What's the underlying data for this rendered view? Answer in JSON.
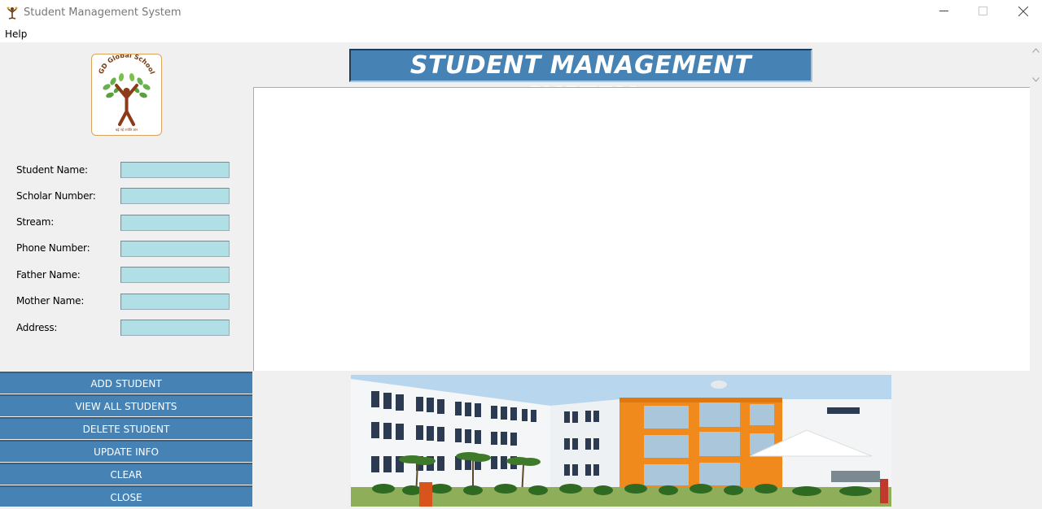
{
  "window": {
    "title": "Student Management System",
    "minimize_icon": "minimize-icon",
    "maximize_icon": "maximize-icon",
    "close_icon": "close-icon"
  },
  "menu": {
    "help": "Help"
  },
  "logo": {
    "text": "GD Global School",
    "tagline": "बढ़ें नई ज्योति ज्ञान",
    "accent": "#d9a55a"
  },
  "header": {
    "title": "STUDENT MANAGEMENT SYSTEM",
    "bg_color": "#4682b4"
  },
  "form": {
    "fields": [
      {
        "label": "Student Name:",
        "value": ""
      },
      {
        "label": "Scholar Number:",
        "value": ""
      },
      {
        "label": "Stream:",
        "value": ""
      },
      {
        "label": "Phone Number:",
        "value": ""
      },
      {
        "label": "Father Name:",
        "value": ""
      },
      {
        "label": "Mother Name:",
        "value": ""
      },
      {
        "label": "Address:",
        "value": ""
      }
    ],
    "input_color": "#b0e0e6"
  },
  "buttons": {
    "add": "ADD STUDENT",
    "view_all": "VIEW ALL STUDENTS",
    "delete": "DELETE STUDENT",
    "update": "UPDATE INFO",
    "clear": "CLEAR",
    "close": "CLOSE",
    "color": "#4682b4"
  },
  "photo": {
    "subject": "school-building-photo"
  }
}
